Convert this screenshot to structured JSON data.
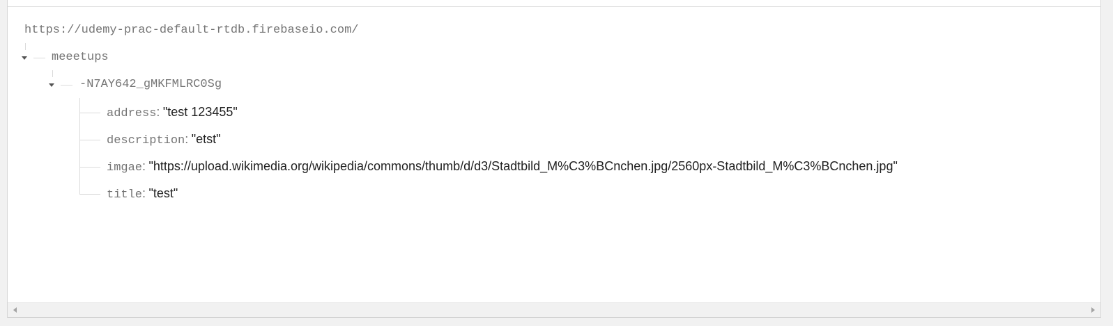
{
  "database": {
    "root_url": "https://udemy-prac-default-rtdb.firebaseio.com/"
  },
  "tree": {
    "collection": {
      "key": "meeetups"
    },
    "record": {
      "key": "-N7AY642_gMKFMLRC0Sg",
      "fields": [
        {
          "name": "address",
          "separator": ":",
          "value": "\"test 123455\""
        },
        {
          "name": "description",
          "separator": ":",
          "value": "\"etst\""
        },
        {
          "name": "imgae",
          "separator": ":",
          "value": "\"https://upload.wikimedia.org/wikipedia/commons/thumb/d/d3/Stadtbild_M%C3%BCnchen.jpg/2560px-Stadtbild_M%C3%BCnchen.jpg\""
        },
        {
          "name": "title",
          "separator": ":",
          "value": "\"test\""
        }
      ]
    }
  },
  "icons": {
    "expand": "caret-down-icon",
    "scroll_left": "scroll-left-arrow-icon",
    "scroll_right": "scroll-right-arrow-icon"
  },
  "colors": {
    "key_text": "#757575",
    "value_text": "#212121",
    "tree_lines": "#dadada"
  }
}
